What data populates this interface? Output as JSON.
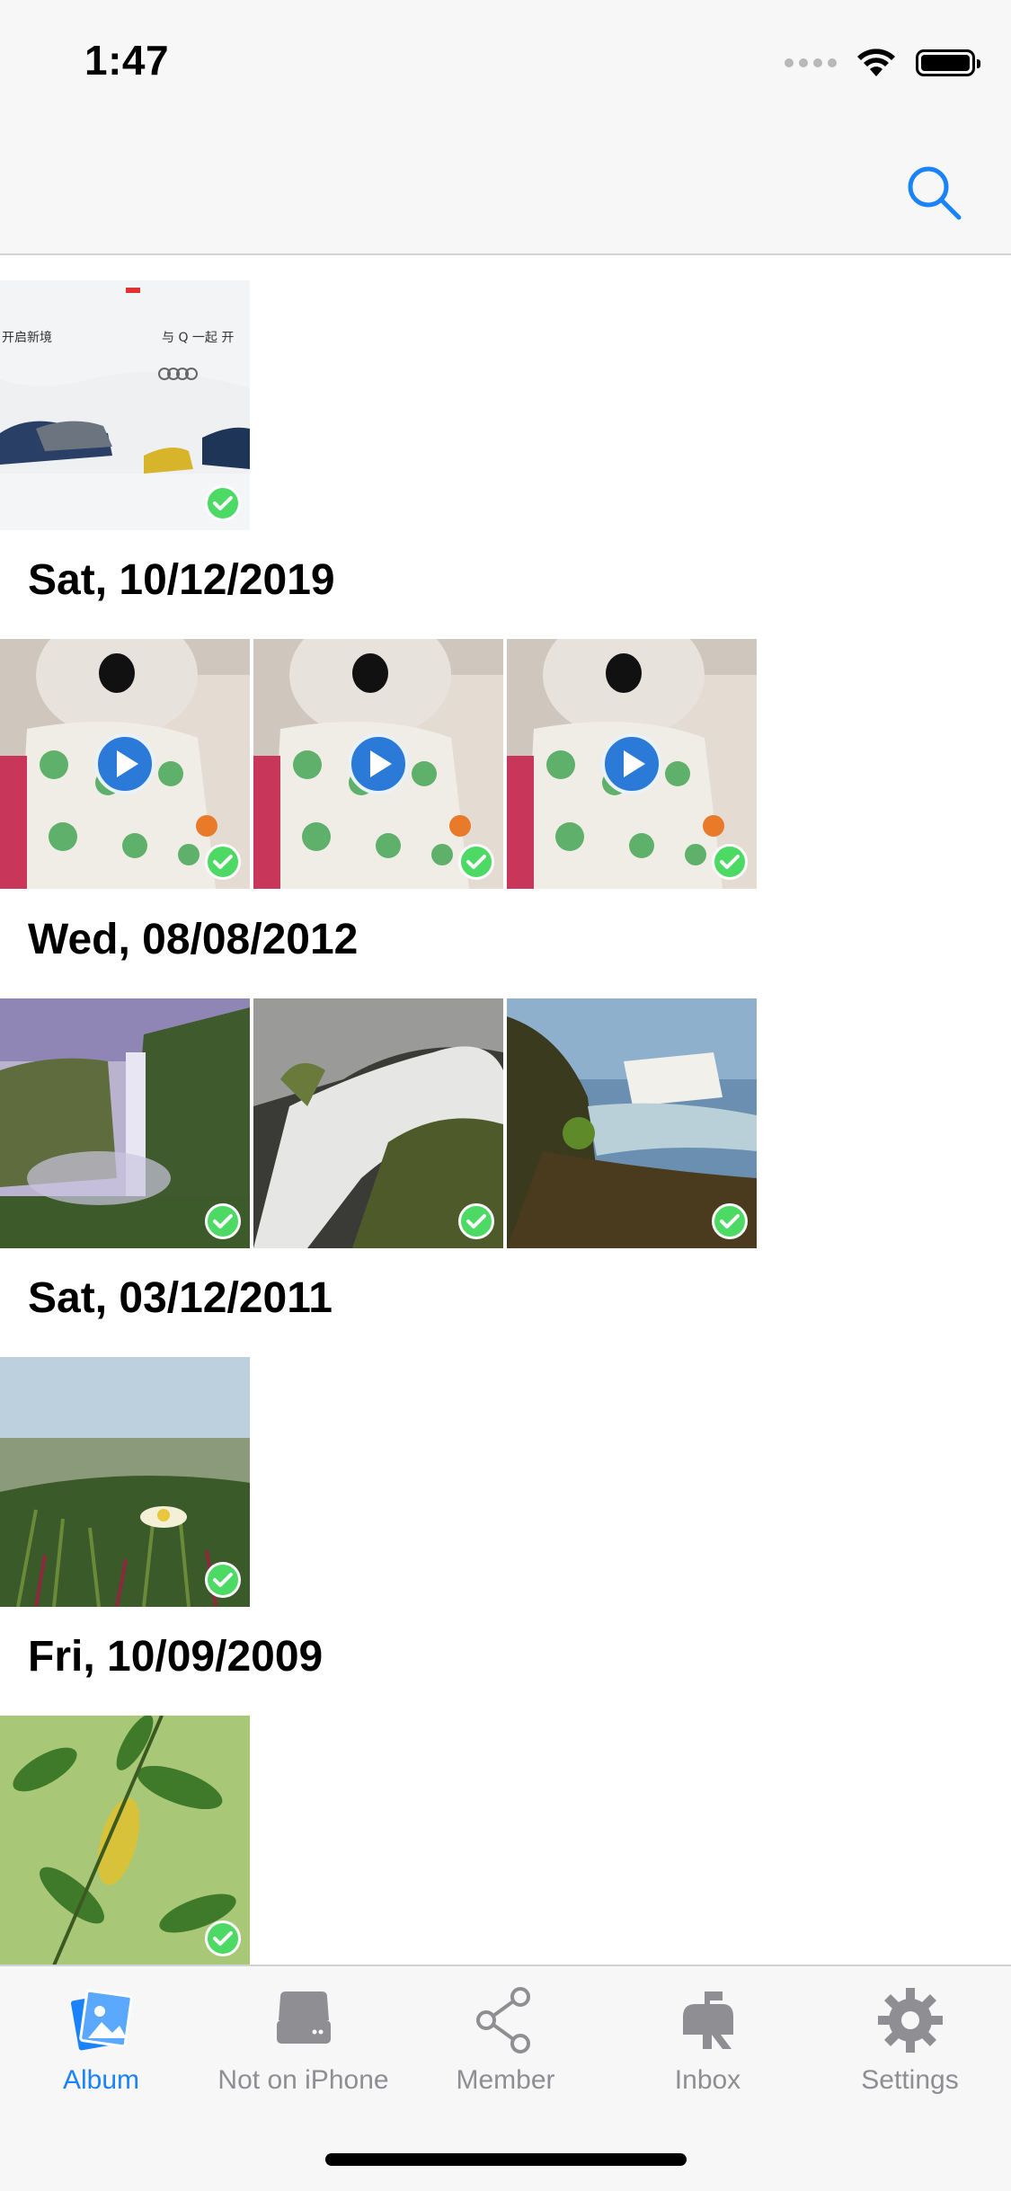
{
  "status_bar": {
    "time": "1:47"
  },
  "sections": [
    {
      "date": "Sat, 10/12/2019"
    },
    {
      "date": "Wed, 08/08/2012"
    },
    {
      "date": "Sat, 03/12/2011"
    },
    {
      "date": "Fri, 10/09/2009"
    }
  ],
  "ad_text": {
    "left": "开启新境",
    "right": "与 Q 一起 开",
    "brand": "Audi"
  },
  "tabs": [
    {
      "label": "Album",
      "icon": "album-icon",
      "active": true
    },
    {
      "label": "Not on iPhone",
      "icon": "drive-icon",
      "active": false
    },
    {
      "label": "Member",
      "icon": "share-icon",
      "active": false
    },
    {
      "label": "Inbox",
      "icon": "mailbox-icon",
      "active": false
    },
    {
      "label": "Settings",
      "icon": "gear-icon",
      "active": false
    }
  ],
  "colors": {
    "accent": "#1a82fb",
    "check": "#4cd964",
    "play": "#2b7ad8"
  }
}
